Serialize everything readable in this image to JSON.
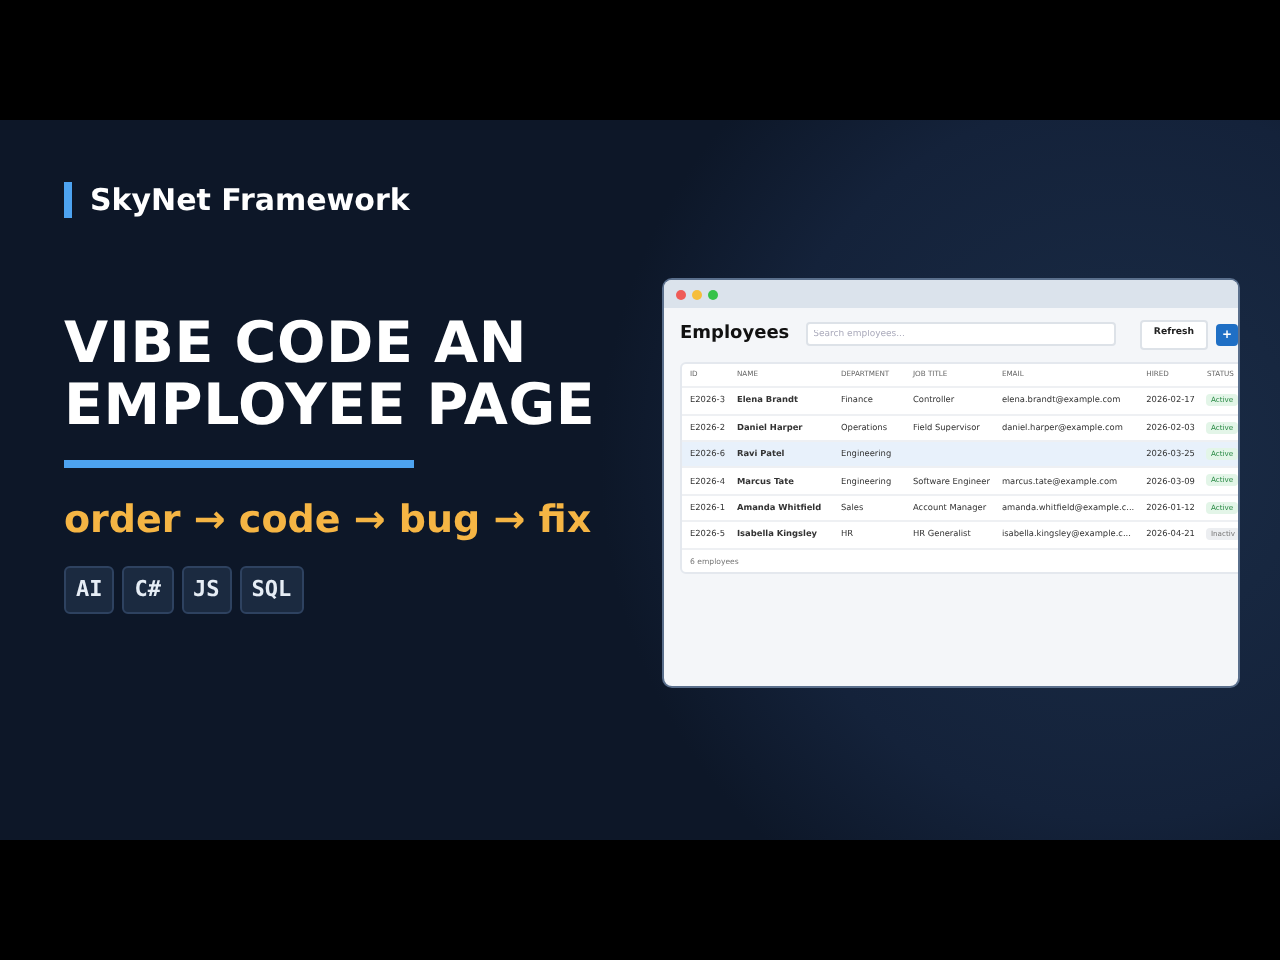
{
  "brand": "SkyNet Framework",
  "headline": "VIBE CODE AN EMPLOYEE PAGE",
  "subtitle": "order → code → bug → fix",
  "tags": [
    "AI",
    "C#",
    "JS",
    "SQL"
  ],
  "app": {
    "title": "Employees",
    "search": {
      "placeholder": "Search employees..."
    },
    "buttons": [
      {
        "label": "Refresh",
        "kind": "plain"
      },
      {
        "label": "+",
        "kind": "primary"
      }
    ],
    "table": {
      "columns": [
        "ID",
        "NAME",
        "DEPARTMENT",
        "JOB TITLE",
        "EMAIL",
        "HIRED",
        "STATUS"
      ],
      "rows": [
        {
          "id": "E2026-3",
          "name": "Elena Brandt",
          "department": "Finance",
          "job_title": "Controller",
          "email": "elena.brandt@example.com",
          "hired": "2026-02-17",
          "status": "Active",
          "active": true,
          "selected": false
        },
        {
          "id": "E2026-2",
          "name": "Daniel Harper",
          "department": "Operations",
          "job_title": "Field Supervisor",
          "email": "daniel.harper@example.com",
          "hired": "2026-02-03",
          "status": "Active",
          "active": true,
          "selected": false
        },
        {
          "id": "E2026-6",
          "name": "Ravi Patel",
          "department": "Engineering",
          "job_title": "",
          "email": "",
          "hired": "2026-03-25",
          "status": "Active",
          "active": true,
          "selected": true
        },
        {
          "id": "E2026-4",
          "name": "Marcus Tate",
          "department": "Engineering",
          "job_title": "Software Engineer",
          "email": "marcus.tate@example.com",
          "hired": "2026-03-09",
          "status": "Active",
          "active": true,
          "selected": false
        },
        {
          "id": "E2026-1",
          "name": "Amanda Whitfield",
          "department": "Sales",
          "job_title": "Account Manager",
          "email": "amanda.whitfield@example.c...",
          "hired": "2026-01-12",
          "status": "Active",
          "active": true,
          "selected": false
        },
        {
          "id": "E2026-5",
          "name": "Isabella Kingsley",
          "department": "HR",
          "job_title": "HR Generalist",
          "email": "isabella.kingsley@example.c...",
          "hired": "2026-04-21",
          "status": "Inactiv",
          "active": false,
          "selected": false
        }
      ]
    },
    "footer": "6 employees"
  }
}
